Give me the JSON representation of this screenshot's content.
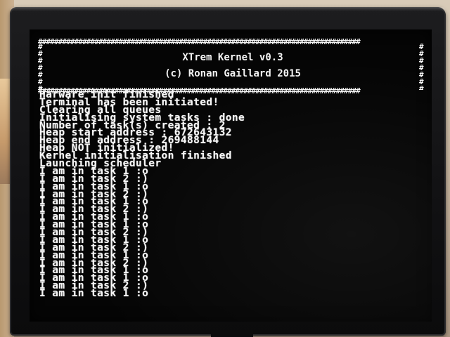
{
  "banner": {
    "title": "XTrem Kernel v0.3",
    "copyright": "(c) Ronan Gaillard 2015",
    "border_char": "#"
  },
  "log_lines": [
    "Harware init finished",
    "Terminal has been initiated!",
    "Clearing all queues",
    "Initialising system tasks : done",
    "Number of task(s) created : 2",
    "Heap start address : 672643132",
    "Heap end address : 269488144",
    "Heap NOT initialized!",
    "Kernel initialisation finished",
    "Launching scheduler",
    "I am in task 1 :o",
    "I am in task 2 :)",
    "I am in task 1 :o",
    "I am in task 2 :)",
    "I am in task 1 :o",
    "I am in task 2 :)",
    "I am in task 1 :o",
    "I am in task 1 :o",
    "I am in task 2 :)",
    "I am in task 1 :o",
    "I am in task 2 :)",
    "I am in task 1 :o",
    "I am in task 2 :)",
    "I am in task 1 :o",
    "I am in task 1 :o",
    "I am in task 2 :)",
    "I am in task 1 :o"
  ],
  "colors": {
    "screen_bg": "#050505",
    "text": "#f4f4f4",
    "bezel": "#111113"
  }
}
